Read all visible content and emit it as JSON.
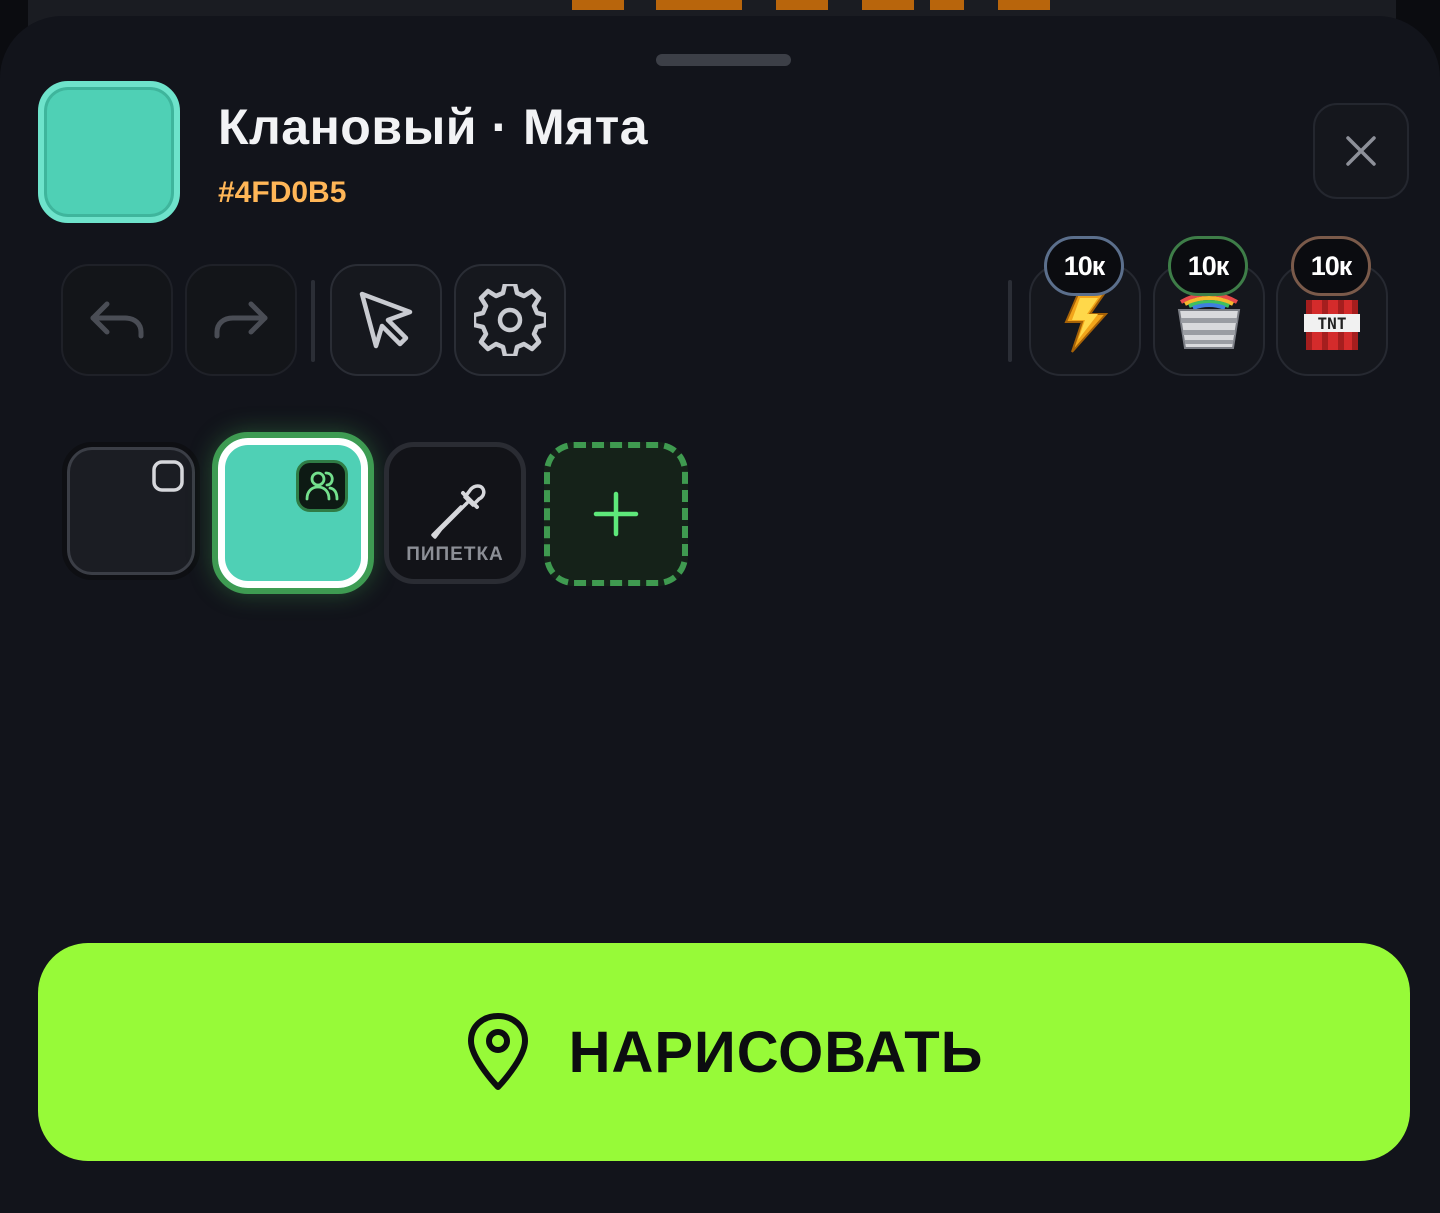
{
  "header": {
    "title": "Клановый · Мята",
    "hex": "#4FD0B5",
    "color": "#4FD0B5"
  },
  "toolbar": {
    "undo_icon": "undo-icon",
    "redo_icon": "redo-icon",
    "select_icon": "cursor-icon",
    "settings_icon": "gear-icon"
  },
  "powerups": [
    {
      "name": "lightning",
      "count": "10к",
      "icon": "lightning-icon",
      "ring": "#5b6f8c"
    },
    {
      "name": "paint-bucket",
      "count": "10к",
      "icon": "rainbow-bucket-icon",
      "ring": "#3e7d48"
    },
    {
      "name": "tnt",
      "count": "10к",
      "icon": "tnt-icon",
      "ring": "#7a5a4a"
    }
  ],
  "palette": {
    "selected_color": "#4FD0B5",
    "pipette_label": "ПИПЕТКА"
  },
  "action": {
    "draw_label": "НАРИСОВАТЬ",
    "color": "#97fa38"
  }
}
